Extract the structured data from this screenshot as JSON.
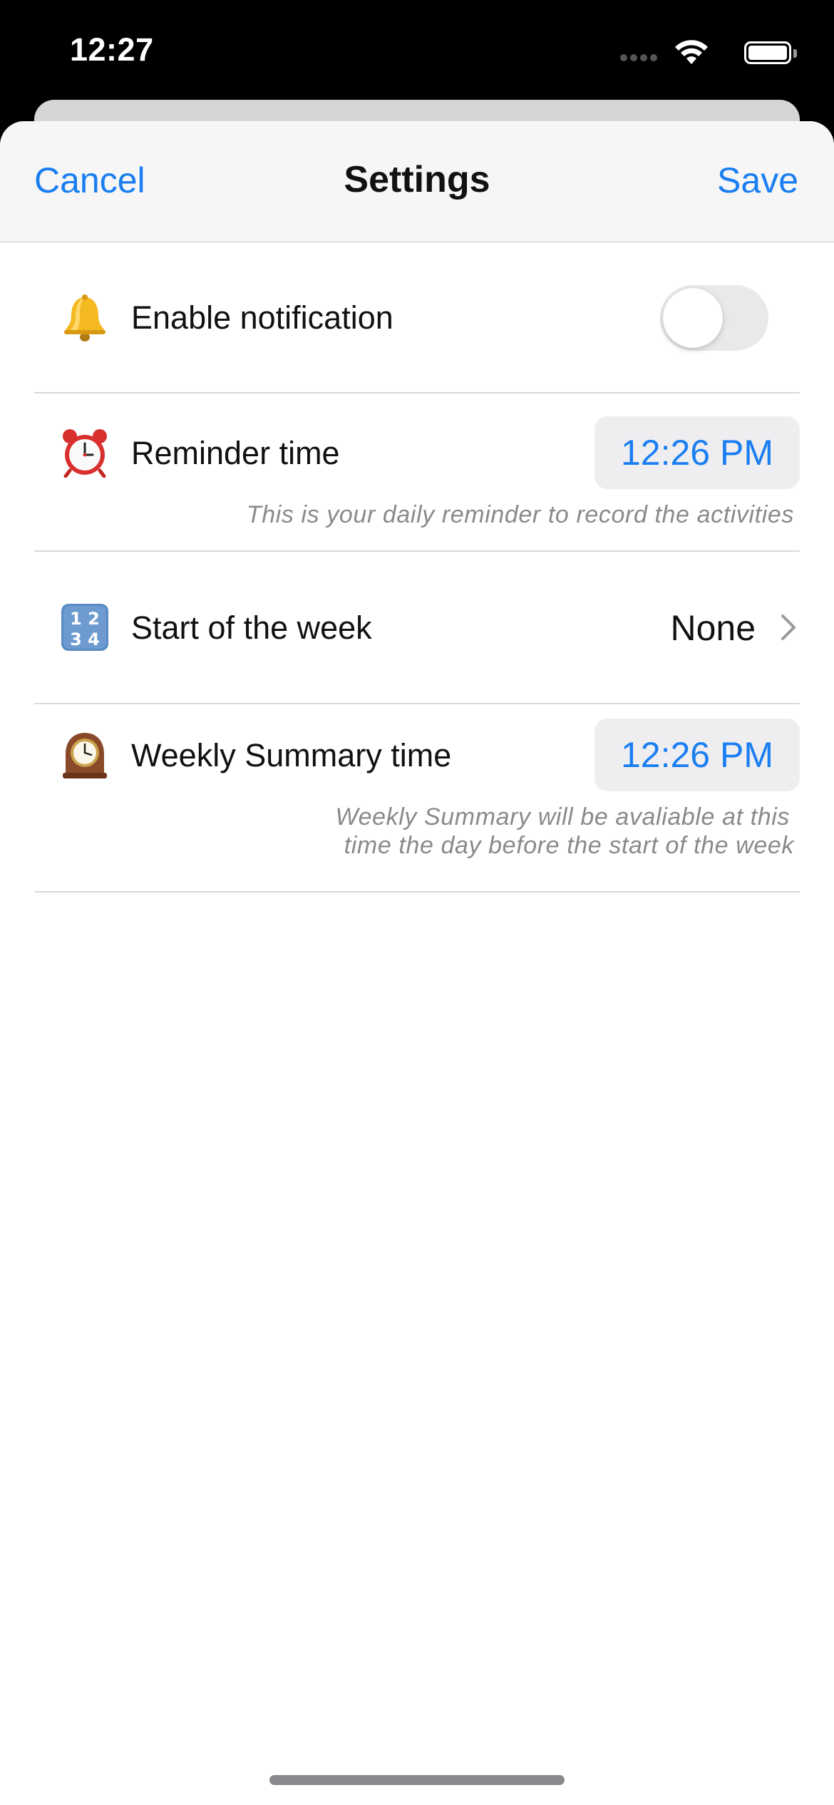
{
  "status_bar": {
    "time": "12:27",
    "icons": [
      "cellular-signal-icon",
      "wifi-icon",
      "battery-icon"
    ]
  },
  "nav": {
    "cancel_label": "Cancel",
    "title": "Settings",
    "save_label": "Save"
  },
  "settings": {
    "notification": {
      "icon": "bell-icon",
      "label": "Enable notification",
      "enabled": false
    },
    "reminder": {
      "icon": "alarm-clock-icon",
      "label": "Reminder time",
      "value": "12:26 PM",
      "hint": "This is your daily reminder to record the activities"
    },
    "week_start": {
      "icon": "input-numbers-icon",
      "label": "Start of the week",
      "value": "None"
    },
    "weekly_summary": {
      "icon": "mantelpiece-clock-icon",
      "label": "Weekly Summary time",
      "value": "12:26 PM",
      "hint_line1": "Weekly Summary will be avaliable at this",
      "hint_line2": "time the day before the start of the week"
    }
  },
  "colors": {
    "accent": "#1a7ef2",
    "nav_background": "#f6f6f6",
    "pill_background": "#eeeef0",
    "hint_text": "#8a8a8e"
  }
}
